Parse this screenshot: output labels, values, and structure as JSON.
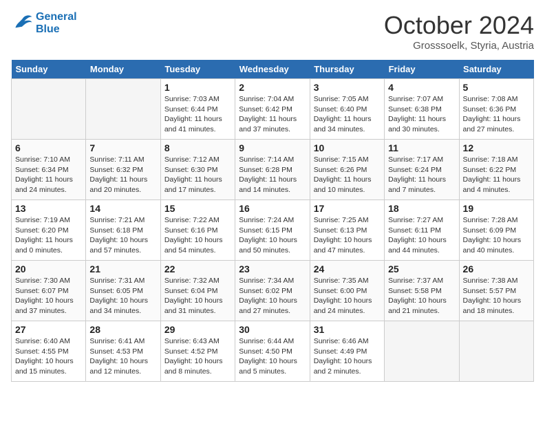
{
  "header": {
    "logo_line1": "General",
    "logo_line2": "Blue",
    "month": "October 2024",
    "location": "Grosssoelk, Styria, Austria"
  },
  "days_of_week": [
    "Sunday",
    "Monday",
    "Tuesday",
    "Wednesday",
    "Thursday",
    "Friday",
    "Saturday"
  ],
  "weeks": [
    [
      {
        "num": "",
        "info": "",
        "empty": true
      },
      {
        "num": "",
        "info": "",
        "empty": true
      },
      {
        "num": "1",
        "info": "Sunrise: 7:03 AM\nSunset: 6:44 PM\nDaylight: 11 hours and 41 minutes."
      },
      {
        "num": "2",
        "info": "Sunrise: 7:04 AM\nSunset: 6:42 PM\nDaylight: 11 hours and 37 minutes."
      },
      {
        "num": "3",
        "info": "Sunrise: 7:05 AM\nSunset: 6:40 PM\nDaylight: 11 hours and 34 minutes."
      },
      {
        "num": "4",
        "info": "Sunrise: 7:07 AM\nSunset: 6:38 PM\nDaylight: 11 hours and 30 minutes."
      },
      {
        "num": "5",
        "info": "Sunrise: 7:08 AM\nSunset: 6:36 PM\nDaylight: 11 hours and 27 minutes."
      }
    ],
    [
      {
        "num": "6",
        "info": "Sunrise: 7:10 AM\nSunset: 6:34 PM\nDaylight: 11 hours and 24 minutes."
      },
      {
        "num": "7",
        "info": "Sunrise: 7:11 AM\nSunset: 6:32 PM\nDaylight: 11 hours and 20 minutes."
      },
      {
        "num": "8",
        "info": "Sunrise: 7:12 AM\nSunset: 6:30 PM\nDaylight: 11 hours and 17 minutes."
      },
      {
        "num": "9",
        "info": "Sunrise: 7:14 AM\nSunset: 6:28 PM\nDaylight: 11 hours and 14 minutes."
      },
      {
        "num": "10",
        "info": "Sunrise: 7:15 AM\nSunset: 6:26 PM\nDaylight: 11 hours and 10 minutes."
      },
      {
        "num": "11",
        "info": "Sunrise: 7:17 AM\nSunset: 6:24 PM\nDaylight: 11 hours and 7 minutes."
      },
      {
        "num": "12",
        "info": "Sunrise: 7:18 AM\nSunset: 6:22 PM\nDaylight: 11 hours and 4 minutes."
      }
    ],
    [
      {
        "num": "13",
        "info": "Sunrise: 7:19 AM\nSunset: 6:20 PM\nDaylight: 11 hours and 0 minutes."
      },
      {
        "num": "14",
        "info": "Sunrise: 7:21 AM\nSunset: 6:18 PM\nDaylight: 10 hours and 57 minutes."
      },
      {
        "num": "15",
        "info": "Sunrise: 7:22 AM\nSunset: 6:16 PM\nDaylight: 10 hours and 54 minutes."
      },
      {
        "num": "16",
        "info": "Sunrise: 7:24 AM\nSunset: 6:15 PM\nDaylight: 10 hours and 50 minutes."
      },
      {
        "num": "17",
        "info": "Sunrise: 7:25 AM\nSunset: 6:13 PM\nDaylight: 10 hours and 47 minutes."
      },
      {
        "num": "18",
        "info": "Sunrise: 7:27 AM\nSunset: 6:11 PM\nDaylight: 10 hours and 44 minutes."
      },
      {
        "num": "19",
        "info": "Sunrise: 7:28 AM\nSunset: 6:09 PM\nDaylight: 10 hours and 40 minutes."
      }
    ],
    [
      {
        "num": "20",
        "info": "Sunrise: 7:30 AM\nSunset: 6:07 PM\nDaylight: 10 hours and 37 minutes."
      },
      {
        "num": "21",
        "info": "Sunrise: 7:31 AM\nSunset: 6:05 PM\nDaylight: 10 hours and 34 minutes."
      },
      {
        "num": "22",
        "info": "Sunrise: 7:32 AM\nSunset: 6:04 PM\nDaylight: 10 hours and 31 minutes."
      },
      {
        "num": "23",
        "info": "Sunrise: 7:34 AM\nSunset: 6:02 PM\nDaylight: 10 hours and 27 minutes."
      },
      {
        "num": "24",
        "info": "Sunrise: 7:35 AM\nSunset: 6:00 PM\nDaylight: 10 hours and 24 minutes."
      },
      {
        "num": "25",
        "info": "Sunrise: 7:37 AM\nSunset: 5:58 PM\nDaylight: 10 hours and 21 minutes."
      },
      {
        "num": "26",
        "info": "Sunrise: 7:38 AM\nSunset: 5:57 PM\nDaylight: 10 hours and 18 minutes."
      }
    ],
    [
      {
        "num": "27",
        "info": "Sunrise: 6:40 AM\nSunset: 4:55 PM\nDaylight: 10 hours and 15 minutes."
      },
      {
        "num": "28",
        "info": "Sunrise: 6:41 AM\nSunset: 4:53 PM\nDaylight: 10 hours and 12 minutes."
      },
      {
        "num": "29",
        "info": "Sunrise: 6:43 AM\nSunset: 4:52 PM\nDaylight: 10 hours and 8 minutes."
      },
      {
        "num": "30",
        "info": "Sunrise: 6:44 AM\nSunset: 4:50 PM\nDaylight: 10 hours and 5 minutes."
      },
      {
        "num": "31",
        "info": "Sunrise: 6:46 AM\nSunset: 4:49 PM\nDaylight: 10 hours and 2 minutes."
      },
      {
        "num": "",
        "info": "",
        "empty": true
      },
      {
        "num": "",
        "info": "",
        "empty": true
      }
    ]
  ]
}
